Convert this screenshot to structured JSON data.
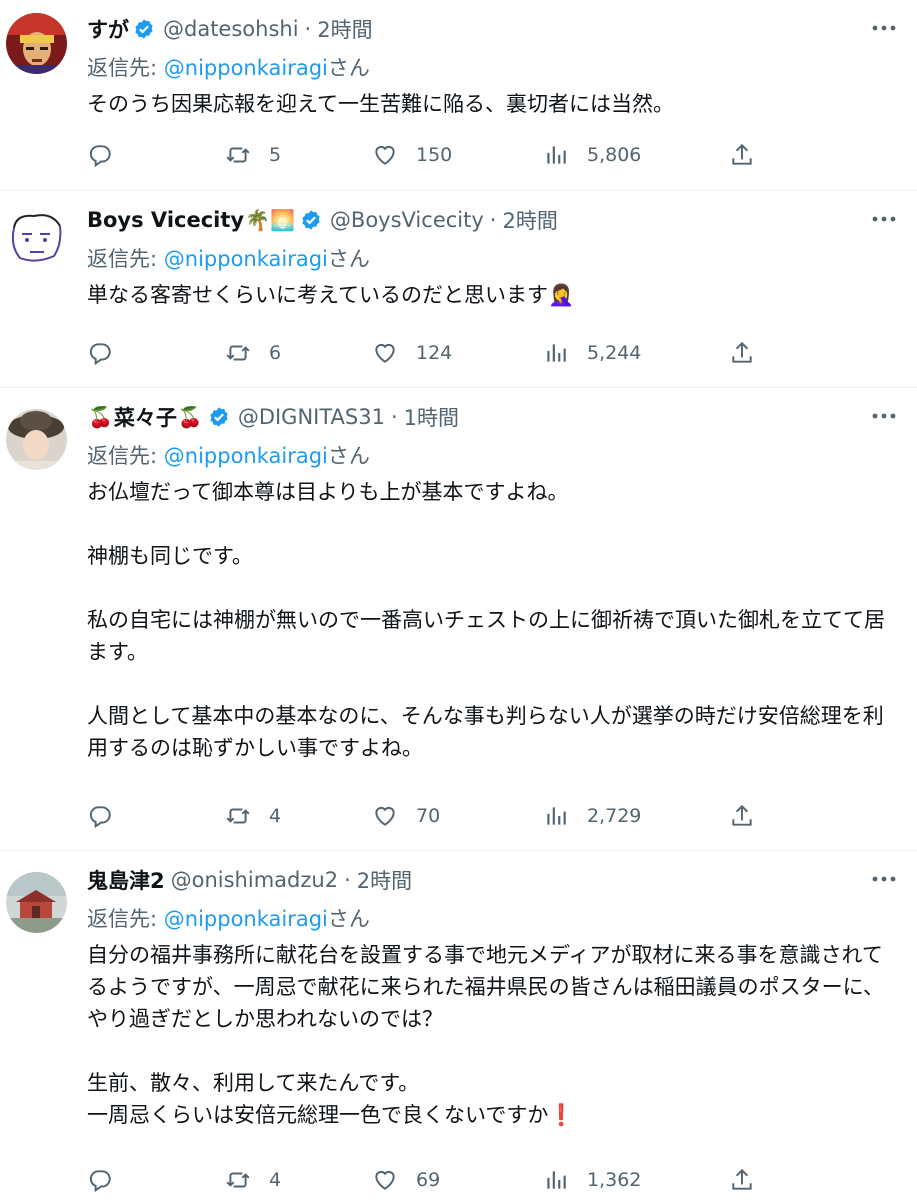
{
  "reply_prefix": "返信先: ",
  "reply_suffix": "さん",
  "tweets": [
    {
      "name": "すが",
      "name_prefix_emoji": "",
      "name_suffix_emoji": "",
      "handle": "@datesohshi",
      "time": "2時間",
      "reply_to": "@nipponkairagi",
      "text": "そのうち因果応報を迎えて一生苦難に陥る、裏切者には当然。",
      "replies": "",
      "retweets": "5",
      "likes": "150",
      "views": "5,806"
    },
    {
      "name": "Boys Vicecity",
      "name_prefix_emoji": "",
      "name_suffix_emoji": "🌴🌅",
      "handle": "@BoysVicecity",
      "time": "2時間",
      "reply_to": "@nipponkairagi",
      "text": "単なる客寄せくらいに考えているのだと思います🤦‍♀️",
      "replies": "",
      "retweets": "6",
      "likes": "124",
      "views": "5,244"
    },
    {
      "name": "菜々子",
      "name_prefix_emoji": "🍒",
      "name_suffix_emoji": "🍒",
      "handle": "@DIGNITAS31",
      "time": "1時間",
      "reply_to": "@nipponkairagi",
      "text": "お仏壇だって御本尊は目よりも上が基本ですよね。\n\n神棚も同じです。\n\n私の自宅には神棚が無いので一番高いチェストの上に御祈祷で頂いた御札を立てて居ます。\n\n人間として基本中の基本なのに、そんな事も判らない人が選挙の時だけ安倍総理を利用するのは恥ずかしい事ですよね。",
      "replies": "",
      "retweets": "4",
      "likes": "70",
      "views": "2,729"
    },
    {
      "name": "鬼島津2",
      "name_prefix_emoji": "",
      "name_suffix_emoji": "",
      "handle": "@onishimadzu2",
      "time": "2時間",
      "reply_to": "@nipponkairagi",
      "text": "自分の福井事務所に献花台を設置する事で地元メディアが取材に来る事を意識されてるようですが、一周忌で献花に来られた福井県民の皆さんは稲田議員のポスターに、やり過ぎだとしか思われないのでは？\n\n生前、散々、利用して来たんです。\n一周忌くらいは安倍元総理一色で良くないですか❗️",
      "replies": "",
      "retweets": "4",
      "likes": "69",
      "views": "1,362"
    }
  ]
}
